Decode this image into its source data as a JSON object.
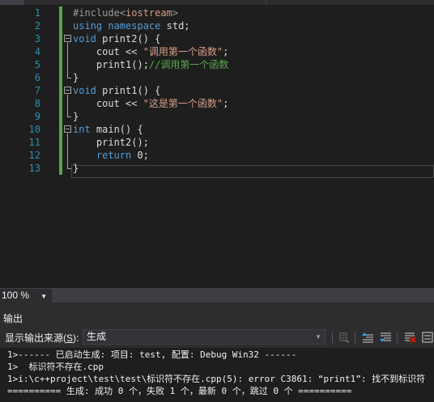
{
  "editor": {
    "line_numbers": [
      "1",
      "2",
      "3",
      "4",
      "5",
      "6",
      "7",
      "8",
      "9",
      "10",
      "11",
      "12",
      "13"
    ],
    "lines": [
      [
        {
          "t": "#include<",
          "c": "pp"
        },
        {
          "t": "iostream",
          "c": "str"
        },
        {
          "t": ">",
          "c": "pp"
        }
      ],
      [
        {
          "t": "using",
          "c": "kw"
        },
        {
          "t": " ",
          "c": "fn"
        },
        {
          "t": "namespace",
          "c": "kw"
        },
        {
          "t": " std;",
          "c": "fn"
        }
      ],
      [
        {
          "t": "void",
          "c": "kw"
        },
        {
          "t": " print2() {",
          "c": "fn"
        }
      ],
      [
        {
          "t": "    cout << ",
          "c": "fn"
        },
        {
          "t": "\"调用第一个函数\"",
          "c": "str"
        },
        {
          "t": ";",
          "c": "fn"
        }
      ],
      [
        {
          "t": "    print1();",
          "c": "fn"
        },
        {
          "t": "//调用第一个函数",
          "c": "cmt"
        }
      ],
      [
        {
          "t": "}",
          "c": "fn"
        }
      ],
      [
        {
          "t": "void",
          "c": "kw"
        },
        {
          "t": " print1() {",
          "c": "fn"
        }
      ],
      [
        {
          "t": "    cout << ",
          "c": "fn"
        },
        {
          "t": "\"这是第一个函数\"",
          "c": "str"
        },
        {
          "t": ";",
          "c": "fn"
        }
      ],
      [
        {
          "t": "}",
          "c": "fn"
        }
      ],
      [
        {
          "t": "int",
          "c": "kw"
        },
        {
          "t": " main() {",
          "c": "fn"
        }
      ],
      [
        {
          "t": "    print2();",
          "c": "fn"
        }
      ],
      [
        {
          "t": "    ",
          "c": "fn"
        },
        {
          "t": "return",
          "c": "kw"
        },
        {
          "t": " 0;",
          "c": "fn"
        }
      ],
      [
        {
          "t": "}",
          "c": "fn"
        }
      ]
    ]
  },
  "zoom": {
    "value": "100 %"
  },
  "output_panel": {
    "title": "输出",
    "source_label_prefix": "显示输出来源(",
    "source_label_key": "S",
    "source_label_suffix": "):",
    "source_value": "生成",
    "lines": [
      "1>------ 已启动生成: 项目: test, 配置: Debug Win32 ------",
      "1>  标识符不存在.cpp",
      "1>i:\\c++project\\test\\test\\标识符不存在.cpp(5): error C3861: “print1”: 找不到标识符",
      "========== 生成: 成功 0 个，失败 1 个，最新 0 个，跳过 0 个 =========="
    ]
  },
  "colors": {
    "keyword": "#569cd6",
    "string": "#d69d85",
    "comment": "#57a64a",
    "line_number": "#2b91af",
    "change_bar": "#57a64a"
  }
}
